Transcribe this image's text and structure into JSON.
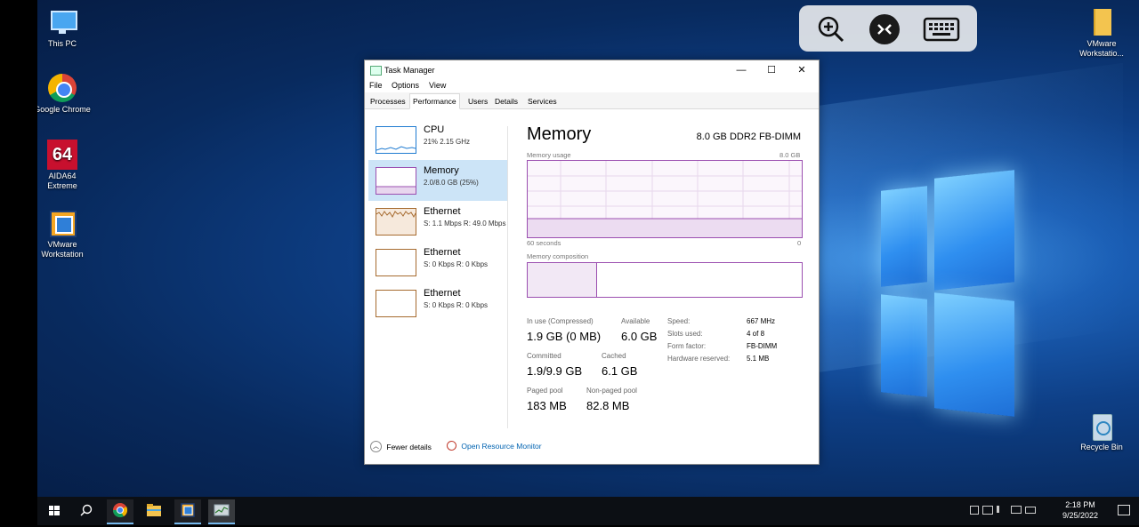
{
  "desktop": {
    "icons": [
      {
        "label": "This PC",
        "icon": "computer-icon"
      },
      {
        "label": "Google Chrome",
        "icon": "chrome-icon"
      },
      {
        "label": "AIDA64 Extreme",
        "icon": "aida64-icon",
        "badge": "64"
      },
      {
        "label": "VMware Workstation",
        "icon": "vmware-icon"
      },
      {
        "label": "VMware Workstatio...",
        "icon": "folder-icon"
      },
      {
        "label": "Recycle Bin",
        "icon": "recycle-bin-icon"
      }
    ]
  },
  "remote_toolbar": {
    "buttons": [
      "zoom-in-icon",
      "remote-desktop-icon",
      "keyboard-icon"
    ]
  },
  "window": {
    "title": "Task Manager",
    "controls": {
      "minimize": "—",
      "maximize": "☐",
      "close": "✕"
    },
    "menu": [
      "File",
      "Options",
      "View"
    ],
    "tabs": [
      "Processes",
      "Performance",
      "Users",
      "Details",
      "Services"
    ],
    "active_tab": "Performance",
    "sidebar": [
      {
        "name": "CPU",
        "sub": "21%  2.15 GHz",
        "color": "#1f7bd1"
      },
      {
        "name": "Memory",
        "sub": "2.0/8.0 GB (25%)",
        "color": "#9b4fb0"
      },
      {
        "name": "Ethernet",
        "sub": "S: 1.1 Mbps  R: 49.0 Mbps",
        "color": "#a66a2e"
      },
      {
        "name": "Ethernet",
        "sub": "S: 0 Kbps  R: 0 Kbps",
        "color": "#a66a2e"
      },
      {
        "name": "Ethernet",
        "sub": "S: 0 Kbps  R: 0 Kbps",
        "color": "#a66a2e"
      }
    ],
    "main": {
      "title": "Memory",
      "spec": "8.0 GB DDR2 FB-DIMM",
      "usage_label": "Memory usage",
      "usage_max": "8.0 GB",
      "time_left": "60 seconds",
      "time_right": "0",
      "composition_label": "Memory composition",
      "usage_fraction": 0.25,
      "inuse_fraction": 0.25,
      "stats": {
        "in_use_label": "In use (Compressed)",
        "in_use_value": "1.9 GB (0 MB)",
        "available_label": "Available",
        "available_value": "6.0 GB",
        "committed_label": "Committed",
        "committed_value": "1.9/9.9 GB",
        "cached_label": "Cached",
        "cached_value": "6.1 GB",
        "paged_label": "Paged pool",
        "paged_value": "183 MB",
        "nonpaged_label": "Non-paged pool",
        "nonpaged_value": "82.8 MB"
      },
      "details": [
        {
          "k": "Speed:",
          "v": "667 MHz"
        },
        {
          "k": "Slots used:",
          "v": "4 of 8"
        },
        {
          "k": "Form factor:",
          "v": "FB-DIMM"
        },
        {
          "k": "Hardware reserved:",
          "v": "5.1 MB"
        }
      ]
    },
    "footer": {
      "fewer_details": "Fewer details",
      "open_monitor": "Open Resource Monitor"
    }
  },
  "taskbar": {
    "time": "2:18 PM",
    "date": "9/25/2022"
  }
}
